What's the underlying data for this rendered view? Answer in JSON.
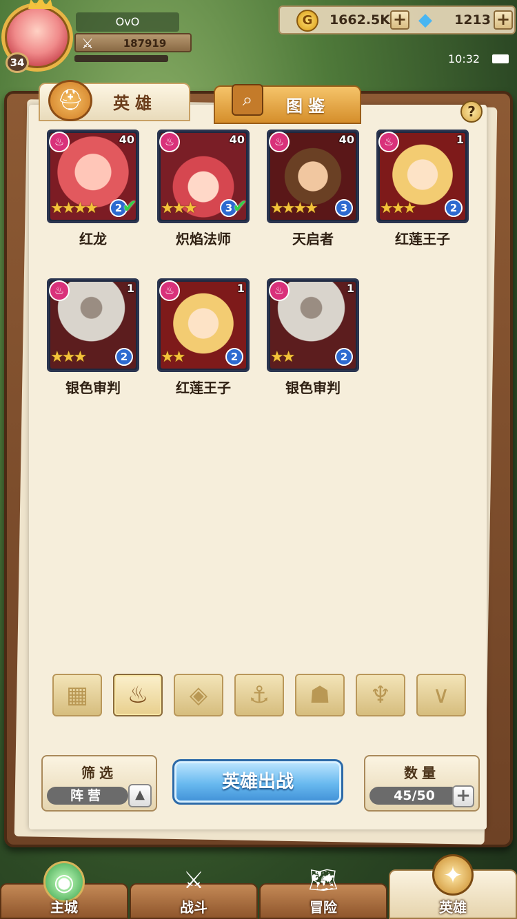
{
  "player": {
    "name": "OvO",
    "level": "34",
    "power": "187919"
  },
  "resources": {
    "gold": "1662.5K",
    "gems": "1213"
  },
  "status": {
    "time": "10:32"
  },
  "tabs": [
    {
      "label": "英雄",
      "active": true
    },
    {
      "label": "图鉴",
      "active": false
    }
  ],
  "help_label": "?",
  "heroes": [
    {
      "name": "红龙",
      "level": "40",
      "stars": "★★★★",
      "rank": "2",
      "deployed": true
    },
    {
      "name": "炽焰法师",
      "level": "40",
      "stars": "★★★",
      "rank": "3",
      "deployed": true
    },
    {
      "name": "天启者",
      "level": "40",
      "stars": "★★★★",
      "rank": "3",
      "deployed": false
    },
    {
      "name": "红莲王子",
      "level": "1",
      "stars": "★★★",
      "rank": "2",
      "deployed": false
    },
    {
      "name": "银色审判",
      "level": "1",
      "stars": "★★★",
      "rank": "2",
      "deployed": false
    },
    {
      "name": "红莲王子",
      "level": "1",
      "stars": "★★",
      "rank": "2",
      "deployed": false
    },
    {
      "name": "银色审判",
      "level": "1",
      "stars": "★★",
      "rank": "2",
      "deployed": false
    }
  ],
  "filter_icons": [
    "grid-icon",
    "flame-icon",
    "diamond-icon",
    "anchor-icon",
    "beast-icon",
    "demon-icon",
    "horns-icon"
  ],
  "active_filter": "flame-icon",
  "bottom": {
    "filter_title": "筛选",
    "filter_value": "阵营",
    "deploy_label": "英雄出战",
    "count_title": "数量",
    "count_value": "45/50"
  },
  "nav": [
    {
      "label": "主城",
      "active": false
    },
    {
      "label": "战斗",
      "active": false
    },
    {
      "label": "冒险",
      "active": false
    },
    {
      "label": "英雄",
      "active": true
    }
  ],
  "colors": {
    "accent_blue": "#68b9ef",
    "element_pink": "#d9317a",
    "rank_blue": "#2d6ad0",
    "check_green": "#34d14a"
  }
}
